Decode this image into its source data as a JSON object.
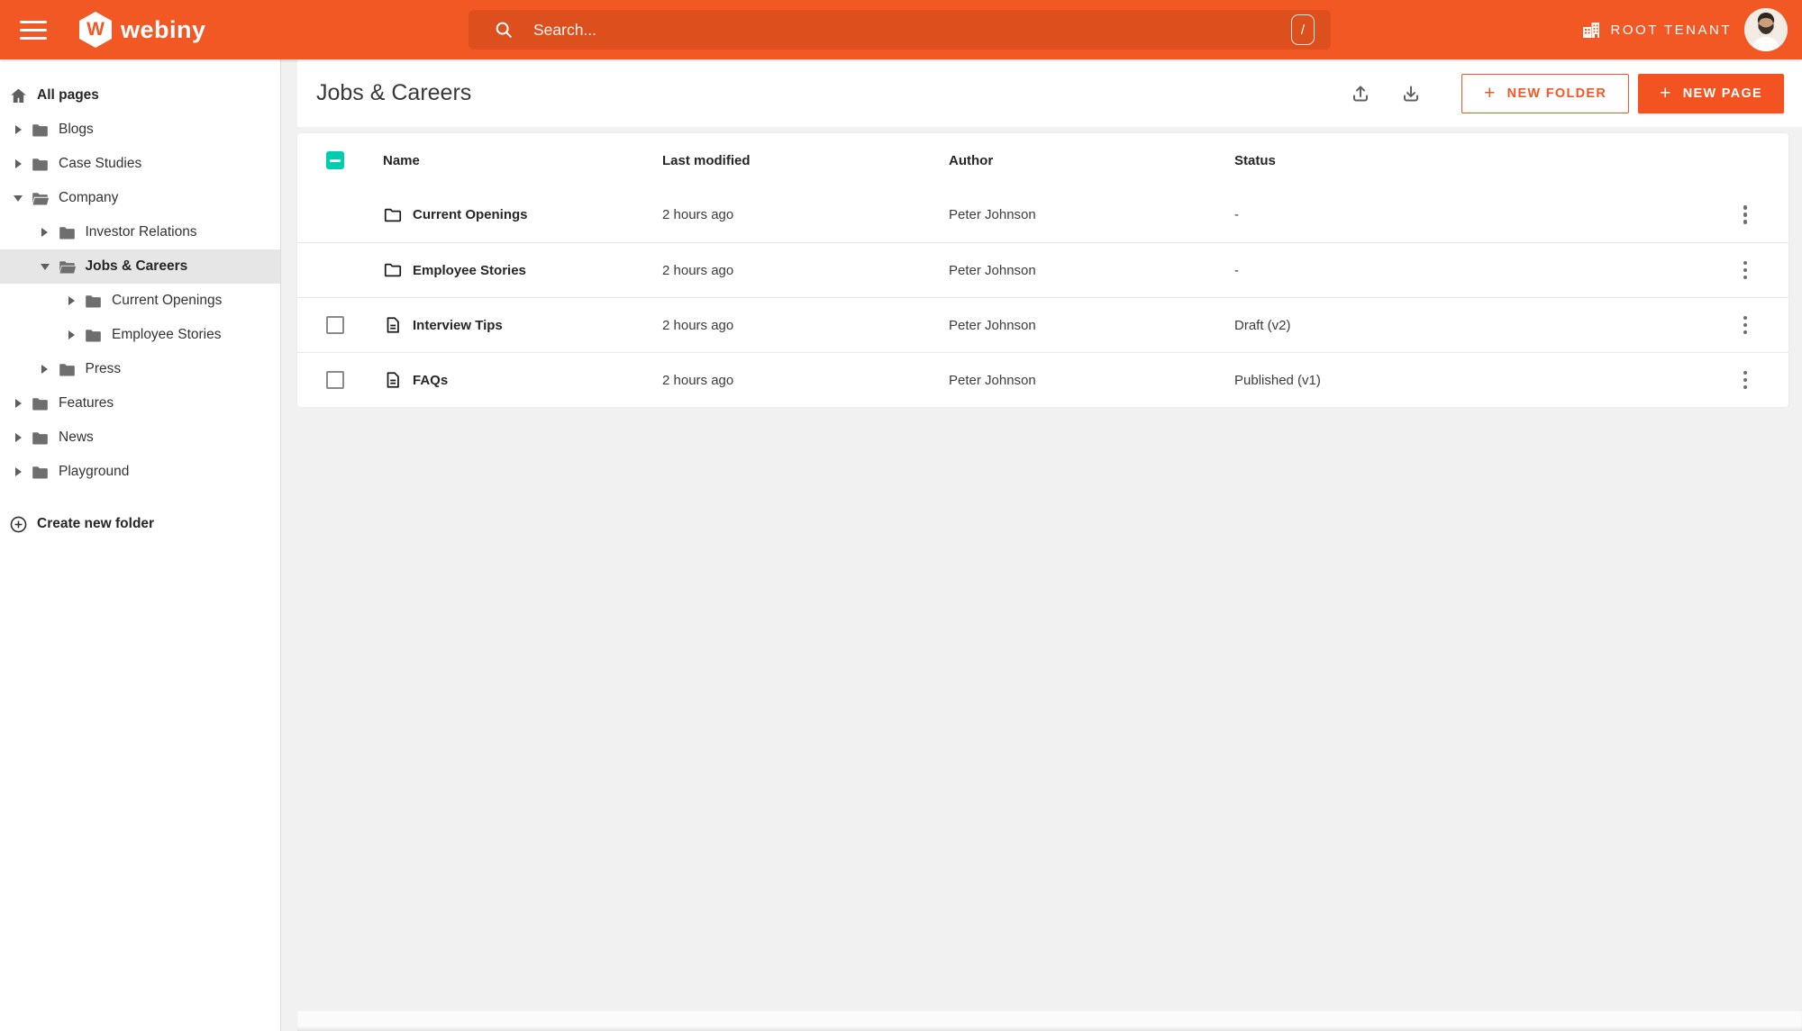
{
  "colors": {
    "brand_orange": "#f25824",
    "search_bg": "#dd4f1d",
    "teal_checkbox": "#00ccb0",
    "sidebar_selected_bg": "#e6e6e6",
    "main_bg": "#f1f1f1"
  },
  "topbar": {
    "logo_letter": "W",
    "logo_word": "webiny",
    "search": {
      "placeholder": "Search...",
      "shortcut_key": "/"
    },
    "tenant_label": "ROOT TENANT"
  },
  "sidebar": {
    "all_pages_label": "All pages",
    "folders": [
      {
        "label": "Blogs",
        "indent": 0,
        "caret": "collapsed",
        "icon": "folder",
        "selected": false,
        "bold": false
      },
      {
        "label": "Case Studies",
        "indent": 0,
        "caret": "collapsed",
        "icon": "folder",
        "selected": false,
        "bold": false
      },
      {
        "label": "Company",
        "indent": 0,
        "caret": "expanded",
        "icon": "folder-open",
        "selected": false,
        "bold": false
      },
      {
        "label": "Investor Relations",
        "indent": 1,
        "caret": "collapsed",
        "icon": "folder",
        "selected": false,
        "bold": false
      },
      {
        "label": "Jobs & Careers",
        "indent": 1,
        "caret": "expanded",
        "icon": "folder-open",
        "selected": true,
        "bold": true
      },
      {
        "label": "Current Openings",
        "indent": 2,
        "caret": "collapsed",
        "icon": "folder",
        "selected": false,
        "bold": false
      },
      {
        "label": "Employee Stories",
        "indent": 2,
        "caret": "collapsed",
        "icon": "folder",
        "selected": false,
        "bold": false
      },
      {
        "label": "Press",
        "indent": 1,
        "caret": "collapsed",
        "icon": "folder",
        "selected": false,
        "bold": false
      },
      {
        "label": "Features",
        "indent": 0,
        "caret": "collapsed",
        "icon": "folder",
        "selected": false,
        "bold": false
      },
      {
        "label": "News",
        "indent": 0,
        "caret": "collapsed",
        "icon": "folder",
        "selected": false,
        "bold": false
      },
      {
        "label": "Playground",
        "indent": 0,
        "caret": "collapsed",
        "icon": "folder",
        "selected": false,
        "bold": false
      }
    ],
    "create_folder_label": "Create new folder"
  },
  "main": {
    "title": "Jobs & Careers",
    "actions": {
      "plus_symbol": "+",
      "new_folder_label": "NEW FOLDER",
      "new_page_label": "NEW PAGE"
    }
  },
  "table": {
    "columns": [
      "Name",
      "Last modified",
      "Author",
      "Status"
    ],
    "rows": [
      {
        "type": "folder",
        "has_checkbox": false,
        "name": "Current Openings",
        "modified": "2 hours ago",
        "author": "Peter Johnson",
        "status": "-"
      },
      {
        "type": "folder",
        "has_checkbox": false,
        "name": "Employee Stories",
        "modified": "2 hours ago",
        "author": "Peter Johnson",
        "status": "-"
      },
      {
        "type": "page",
        "has_checkbox": true,
        "name": "Interview Tips",
        "modified": "2 hours ago",
        "author": "Peter Johnson",
        "status": "Draft (v2)"
      },
      {
        "type": "page",
        "has_checkbox": true,
        "name": "FAQs",
        "modified": "2 hours ago",
        "author": "Peter Johnson",
        "status": "Published (v1)"
      }
    ]
  }
}
